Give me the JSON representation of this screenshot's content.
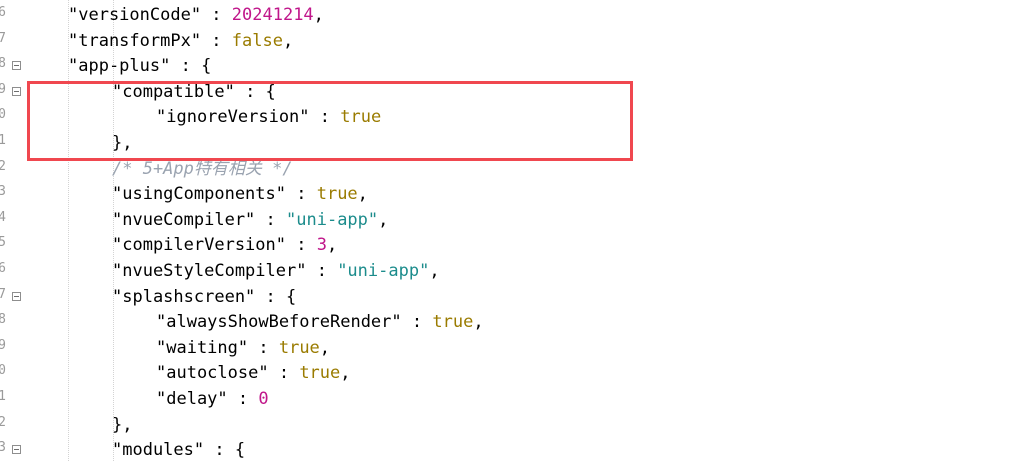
{
  "editor": {
    "lines": [
      {
        "ln": "6",
        "indent": 2,
        "fold": false,
        "tokens": [
          {
            "t": "\"versionCode\"",
            "c": "key"
          },
          {
            "t": " : ",
            "c": "punc"
          },
          {
            "t": "20241214",
            "c": "num"
          },
          {
            "t": ",",
            "c": "punc"
          }
        ]
      },
      {
        "ln": "7",
        "indent": 2,
        "fold": false,
        "tokens": [
          {
            "t": "\"transformPx\"",
            "c": "key"
          },
          {
            "t": " : ",
            "c": "punc"
          },
          {
            "t": "false",
            "c": "bool"
          },
          {
            "t": ",",
            "c": "punc"
          }
        ]
      },
      {
        "ln": "8",
        "indent": 2,
        "fold": true,
        "tokens": [
          {
            "t": "\"app-plus\"",
            "c": "key"
          },
          {
            "t": " : {",
            "c": "punc"
          }
        ]
      },
      {
        "ln": "9",
        "indent": 4,
        "fold": true,
        "tokens": [
          {
            "t": "\"compatible\"",
            "c": "key"
          },
          {
            "t": " : {",
            "c": "punc"
          }
        ]
      },
      {
        "ln": "0",
        "indent": 6,
        "fold": false,
        "tokens": [
          {
            "t": "\"ignoreVersion\"",
            "c": "key"
          },
          {
            "t": " : ",
            "c": "punc"
          },
          {
            "t": "true",
            "c": "bool"
          }
        ]
      },
      {
        "ln": "1",
        "indent": 4,
        "fold": false,
        "tokens": [
          {
            "t": "},",
            "c": "punc"
          }
        ]
      },
      {
        "ln": "2",
        "indent": 4,
        "fold": false,
        "tokens": [
          {
            "t": "/* 5+App特有相关 */",
            "c": "comment"
          }
        ]
      },
      {
        "ln": "3",
        "indent": 4,
        "fold": false,
        "tokens": [
          {
            "t": "\"usingComponents\"",
            "c": "key"
          },
          {
            "t": " : ",
            "c": "punc"
          },
          {
            "t": "true",
            "c": "bool"
          },
          {
            "t": ",",
            "c": "punc"
          }
        ]
      },
      {
        "ln": "4",
        "indent": 4,
        "fold": false,
        "tokens": [
          {
            "t": "\"nvueCompiler\"",
            "c": "key"
          },
          {
            "t": " : ",
            "c": "punc"
          },
          {
            "t": "\"uni-app\"",
            "c": "str"
          },
          {
            "t": ",",
            "c": "punc"
          }
        ]
      },
      {
        "ln": "5",
        "indent": 4,
        "fold": false,
        "tokens": [
          {
            "t": "\"compilerVersion\"",
            "c": "key"
          },
          {
            "t": " : ",
            "c": "punc"
          },
          {
            "t": "3",
            "c": "num"
          },
          {
            "t": ",",
            "c": "punc"
          }
        ]
      },
      {
        "ln": "6",
        "indent": 4,
        "fold": false,
        "tokens": [
          {
            "t": "\"nvueStyleCompiler\"",
            "c": "key"
          },
          {
            "t": " : ",
            "c": "punc"
          },
          {
            "t": "\"uni-app\"",
            "c": "str"
          },
          {
            "t": ",",
            "c": "punc"
          }
        ]
      },
      {
        "ln": "7",
        "indent": 4,
        "fold": true,
        "tokens": [
          {
            "t": "\"splashscreen\"",
            "c": "key"
          },
          {
            "t": " : {",
            "c": "punc"
          }
        ]
      },
      {
        "ln": "8",
        "indent": 6,
        "fold": false,
        "tokens": [
          {
            "t": "\"alwaysShowBeforeRender\"",
            "c": "key"
          },
          {
            "t": " : ",
            "c": "punc"
          },
          {
            "t": "true",
            "c": "bool"
          },
          {
            "t": ",",
            "c": "punc"
          }
        ]
      },
      {
        "ln": "9",
        "indent": 6,
        "fold": false,
        "tokens": [
          {
            "t": "\"waiting\"",
            "c": "key"
          },
          {
            "t": " : ",
            "c": "punc"
          },
          {
            "t": "true",
            "c": "bool"
          },
          {
            "t": ",",
            "c": "punc"
          }
        ]
      },
      {
        "ln": "0",
        "indent": 6,
        "fold": false,
        "tokens": [
          {
            "t": "\"autoclose\"",
            "c": "key"
          },
          {
            "t": " : ",
            "c": "punc"
          },
          {
            "t": "true",
            "c": "bool"
          },
          {
            "t": ",",
            "c": "punc"
          }
        ]
      },
      {
        "ln": "1",
        "indent": 6,
        "fold": false,
        "tokens": [
          {
            "t": "\"delay\"",
            "c": "key"
          },
          {
            "t": " : ",
            "c": "punc"
          },
          {
            "t": "0",
            "c": "num"
          }
        ]
      },
      {
        "ln": "2",
        "indent": 4,
        "fold": false,
        "tokens": [
          {
            "t": "},",
            "c": "punc"
          }
        ]
      },
      {
        "ln": "3",
        "indent": 4,
        "fold": true,
        "tokens": [
          {
            "t": "\"modules\"",
            "c": "key"
          },
          {
            "t": " : {",
            "c": "punc"
          }
        ]
      }
    ]
  },
  "colors": {
    "highlight_border": "#f0474f",
    "number": "#c0168a",
    "boolean": "#9a7b00",
    "string": "#1c8c8c",
    "comment": "#9aa3b0"
  }
}
